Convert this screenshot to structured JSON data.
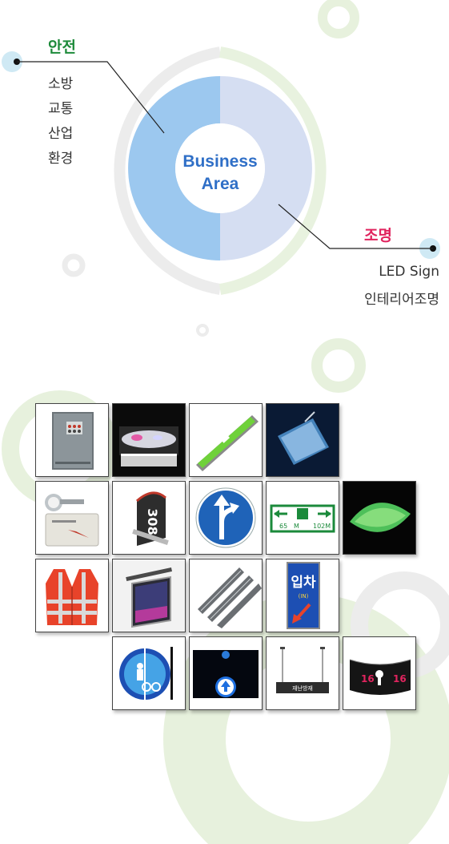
{
  "center": {
    "line1": "Business",
    "line2": "Area"
  },
  "safety": {
    "title": "안전",
    "items": [
      "소방",
      "교통",
      "산업",
      "환경"
    ]
  },
  "lighting": {
    "title": "조명",
    "items": [
      "LED Sign",
      "인테리어조명"
    ]
  },
  "colors": {
    "safety_title": "#1d8a3a",
    "lighting_title": "#e0245e",
    "donut_left": "#9cc8ef",
    "donut_right": "#d5def2",
    "center_text": "#2f6fc7"
  },
  "products": {
    "exit_sign_left": "65",
    "exit_sign_m": "M",
    "exit_sign_right": "102M",
    "parking_big": "입차",
    "parking_small": "(IN)",
    "number_plate": "308",
    "hanging_sign_text": "재난방재",
    "curved_sign_left": "16",
    "curved_sign_right": "16"
  }
}
